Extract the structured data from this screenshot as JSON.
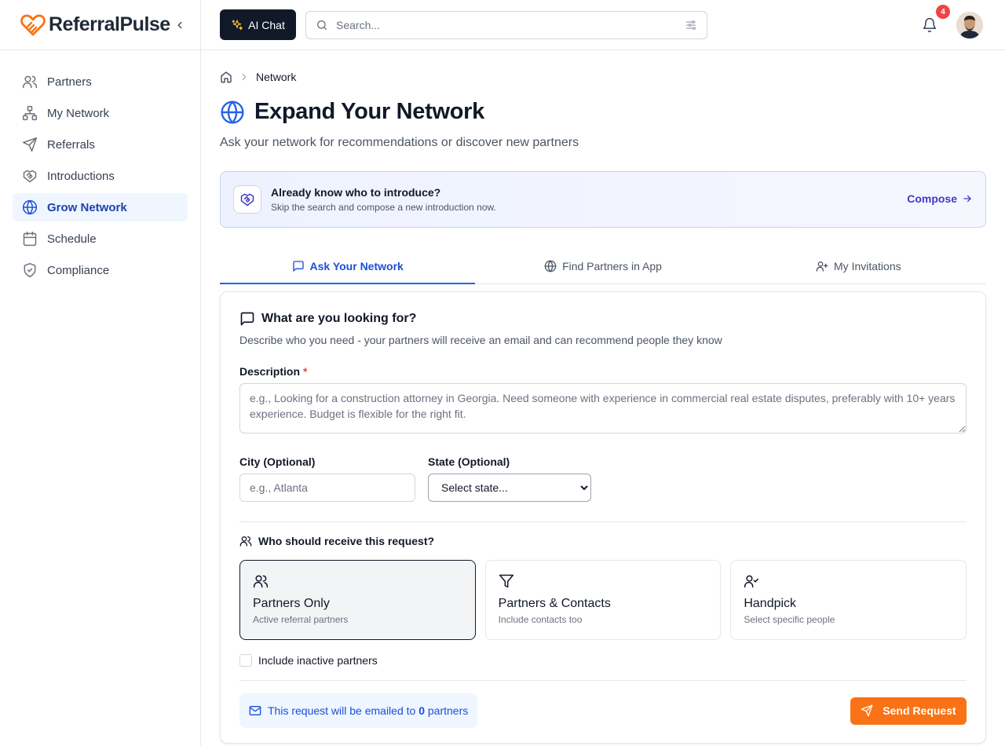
{
  "brand": {
    "name": "ReferralPulse",
    "logo_icon": "heart-handshake-logo",
    "accent": "#f97316"
  },
  "sidebar": {
    "items": [
      {
        "label": "Partners",
        "icon": "users-icon",
        "active": false
      },
      {
        "label": "My Network",
        "icon": "network-icon",
        "active": false
      },
      {
        "label": "Referrals",
        "icon": "send-icon",
        "active": false
      },
      {
        "label": "Introductions",
        "icon": "handshake-icon",
        "active": false
      },
      {
        "label": "Grow Network",
        "icon": "globe-icon",
        "active": true
      },
      {
        "label": "Schedule",
        "icon": "calendar-icon",
        "active": false
      },
      {
        "label": "Compliance",
        "icon": "shield-check-icon",
        "active": false
      }
    ]
  },
  "topbar": {
    "ai_chat_label": "AI Chat",
    "search_placeholder": "Search...",
    "notification_count": "4"
  },
  "breadcrumb": {
    "current": "Network"
  },
  "page": {
    "title": "Expand Your Network",
    "subtitle": "Ask your network for recommendations or discover new partners"
  },
  "banner": {
    "title": "Already know who to introduce?",
    "subtitle": "Skip the search and compose a new introduction now.",
    "link": "Compose"
  },
  "tabs": [
    {
      "label": "Ask Your Network",
      "icon": "message-square-icon",
      "active": true
    },
    {
      "label": "Find Partners in App",
      "icon": "globe-icon",
      "active": false
    },
    {
      "label": "My Invitations",
      "icon": "user-plus-icon",
      "active": false
    }
  ],
  "form": {
    "title": "What are you looking for?",
    "description": "Describe who you need - your partners will receive an email and can recommend people they know",
    "description_label": "Description",
    "required_mark": "*",
    "description_placeholder": "e.g., Looking for a construction attorney in Georgia. Need someone with experience in commercial real estate disputes, preferably with 10+ years experience. Budget is flexible for the right fit.",
    "city_label": "City (Optional)",
    "city_placeholder": "e.g., Atlanta",
    "state_label": "State (Optional)",
    "state_selected": "Select state...",
    "recipients_label": "Who should receive this request?",
    "options": [
      {
        "title": "Partners Only",
        "subtitle": "Active referral partners",
        "icon": "users-icon",
        "selected": true
      },
      {
        "title": "Partners & Contacts",
        "subtitle": "Include contacts too",
        "icon": "filter-icon",
        "selected": false
      },
      {
        "title": "Handpick",
        "subtitle": "Select specific people",
        "icon": "user-check-icon",
        "selected": false
      }
    ],
    "include_inactive_label": "Include inactive partners",
    "include_inactive_checked": false,
    "notice_prefix": "This request will be emailed to",
    "notice_count": "0",
    "notice_suffix": "partners",
    "send_label": "Send Request"
  }
}
